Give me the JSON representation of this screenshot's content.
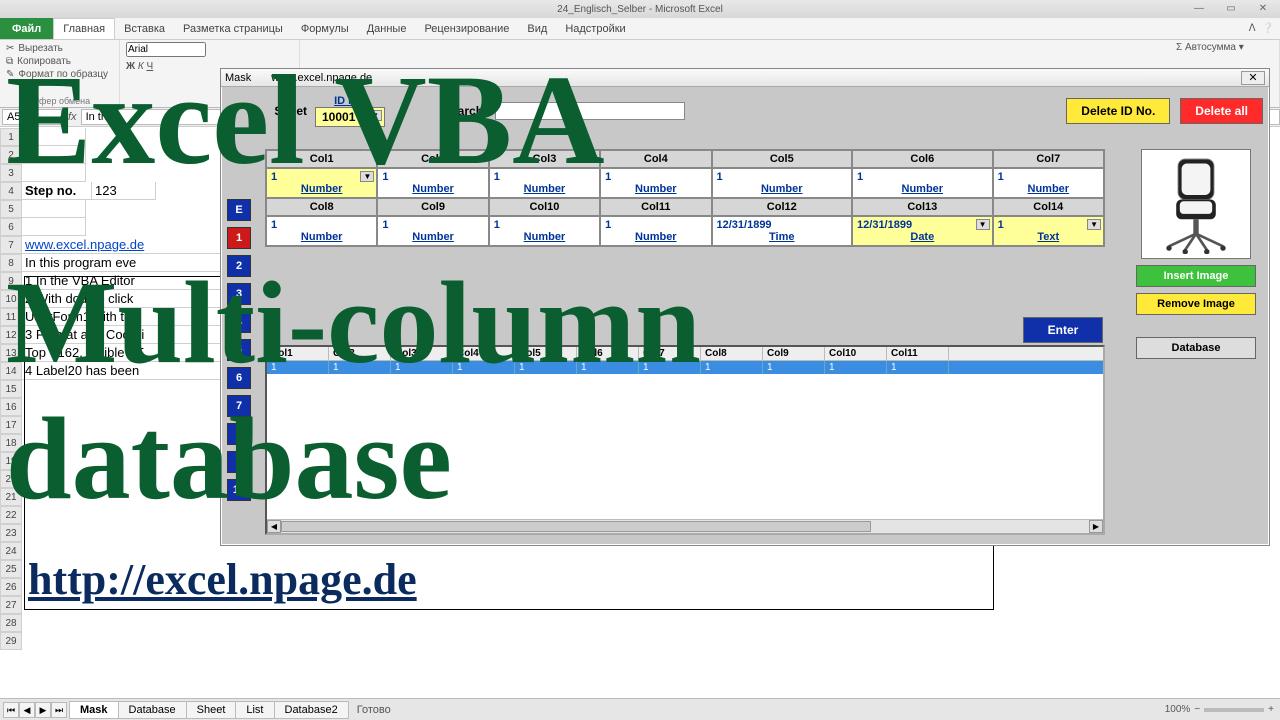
{
  "app_title": "24_Englisch_Selber - Microsoft Excel",
  "ribbon": {
    "file": "Файл",
    "tabs": [
      "Главная",
      "Вставка",
      "Разметка страницы",
      "Формулы",
      "Данные",
      "Рецензирование",
      "Вид",
      "Надстройки"
    ],
    "clipboard": {
      "cut": "Вырезать",
      "copy": "Копировать",
      "format": "Формат по образцу",
      "label": "Буфер обмена"
    },
    "font": {
      "name": "Arial",
      "bold": "Ж",
      "italic": "К",
      "underline": "Ч"
    },
    "autosum": {
      "label": "Σ Автосумма ▾"
    }
  },
  "namebox": "A5",
  "formula_text": "In this",
  "sheet_cells": {
    "row4": {
      "b": "Step no.",
      "c": "123"
    },
    "row8a": "www.excel.npage.de",
    "body_lines": [
      "In this program eve",
      "1 In the VBA Editor",
      "2 With double click",
      "UserForm1 with the",
      "3 Format and Coordi",
      "Top - 162, Visible - F",
      "4 Label20 has been"
    ],
    "biglink": "http://excel.npage.de"
  },
  "sheettabs": {
    "tabs": [
      "Mask",
      "Database",
      "Sheet",
      "List",
      "Database2"
    ],
    "status": "Готово",
    "zoom": "100%"
  },
  "overlay": {
    "l1": "Excel VBA",
    "l2": "Multi-column",
    "l3": "database"
  },
  "mask": {
    "title_left": "Mask",
    "title_right": "www.excel.npage.de",
    "sheet_label": "Sheet",
    "id_label": "ID No.",
    "id_value": "10001",
    "search_label": "Search:",
    "buttons": {
      "delid": "Delete ID No.",
      "delall": "Delete all",
      "enter": "Enter",
      "insimg": "Insert Image",
      "remimg": "Remove Image",
      "db": "Database"
    },
    "nav": [
      "E",
      "1",
      "2",
      "3",
      "4",
      "5",
      "6",
      "7",
      "8",
      "9",
      "10"
    ],
    "grid": {
      "row1_headers": [
        "Col1",
        "Col2",
        "Col3",
        "Col4",
        "Col5",
        "Col6",
        "Col7"
      ],
      "row1_values": [
        "1",
        "1",
        "1",
        "1",
        "1",
        "1",
        "1"
      ],
      "row1_types": [
        "Number",
        "Number",
        "Number",
        "Number",
        "Number",
        "Number",
        "Number"
      ],
      "row2_headers": [
        "Col8",
        "Col9",
        "Col10",
        "Col11",
        "Col12",
        "Col13",
        "Col14"
      ],
      "row2_values": [
        "1",
        "1",
        "1",
        "1",
        "12/31/1899",
        "12/31/1899",
        "1"
      ],
      "row2_types": [
        "Number",
        "Number",
        "Number",
        "Number",
        "Time",
        "Date",
        "Text"
      ]
    },
    "list_headers": [
      "Col1",
      "Col2",
      "Col3",
      "Col4",
      "Col5",
      "Col6",
      "Col7",
      "Col8",
      "Col9",
      "Col10",
      "Col11"
    ],
    "list_row": [
      "1",
      "1",
      "1",
      "1",
      "1",
      "1",
      "1",
      "1",
      "1",
      "1",
      "1"
    ]
  }
}
